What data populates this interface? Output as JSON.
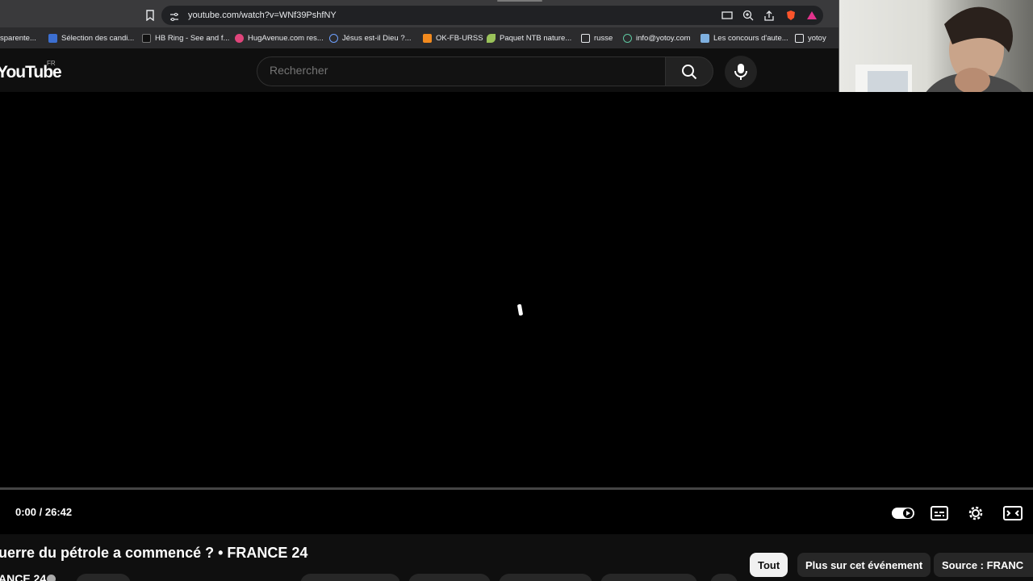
{
  "browser": {
    "url": "youtube.com/watch?v=WNf39PshfNY",
    "bookmarks": [
      {
        "label": "sparente...",
        "icon": "doc-icon"
      },
      {
        "label": "Sélection des candi...",
        "icon": "e-icon"
      },
      {
        "label": "HB Ring - See and f...",
        "icon": "t-icon"
      },
      {
        "label": "HugAvenue.com res...",
        "icon": "heart-icon"
      },
      {
        "label": "Jésus est-il Dieu ?...",
        "icon": "globe-icon"
      },
      {
        "label": "OK-FB-URSS",
        "icon": "ok-icon"
      },
      {
        "label": "Paquet NTB nature...",
        "icon": "leaf-icon"
      },
      {
        "label": "russe",
        "icon": "folder-icon"
      },
      {
        "label": "info@yotoy.com",
        "icon": "globe-icon"
      },
      {
        "label": "Les concours d'aute...",
        "icon": "mail-icon"
      },
      {
        "label": "yotoy",
        "icon": "folder-icon"
      }
    ]
  },
  "masthead": {
    "logo": "YouTube",
    "country": "FR",
    "search_placeholder": "Rechercher"
  },
  "player": {
    "time": "0:00 / 26:42",
    "progress": 0
  },
  "video": {
    "title": "uerre du pétrole a commencé ? • FRANCE 24",
    "channel": "ANCE 24"
  },
  "chips": [
    {
      "label": "Tout",
      "active": true
    },
    {
      "label": "Plus sur cet événement",
      "active": false
    },
    {
      "label": "Source : FRANC",
      "active": false
    }
  ],
  "colors": {
    "background": "#0f0f0f",
    "accent": "#ff0000",
    "chip_active": "#f1f1f1"
  }
}
